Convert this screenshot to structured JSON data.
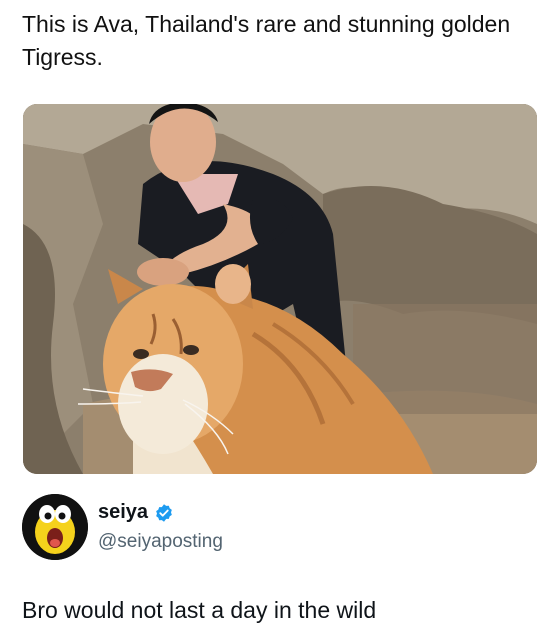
{
  "post": {
    "caption": "This is Ava, Thailand's rare and stunning golden Tigress."
  },
  "author": {
    "display_name": "seiya",
    "handle": "@seiyaposting",
    "verified": true,
    "verified_color": "#1d9bf0"
  },
  "tweet": {
    "text": "Bro would not last a day in the wild"
  },
  "icons": {
    "verified": "verified-badge-icon",
    "avatar": "emoji-avatar-icon"
  }
}
